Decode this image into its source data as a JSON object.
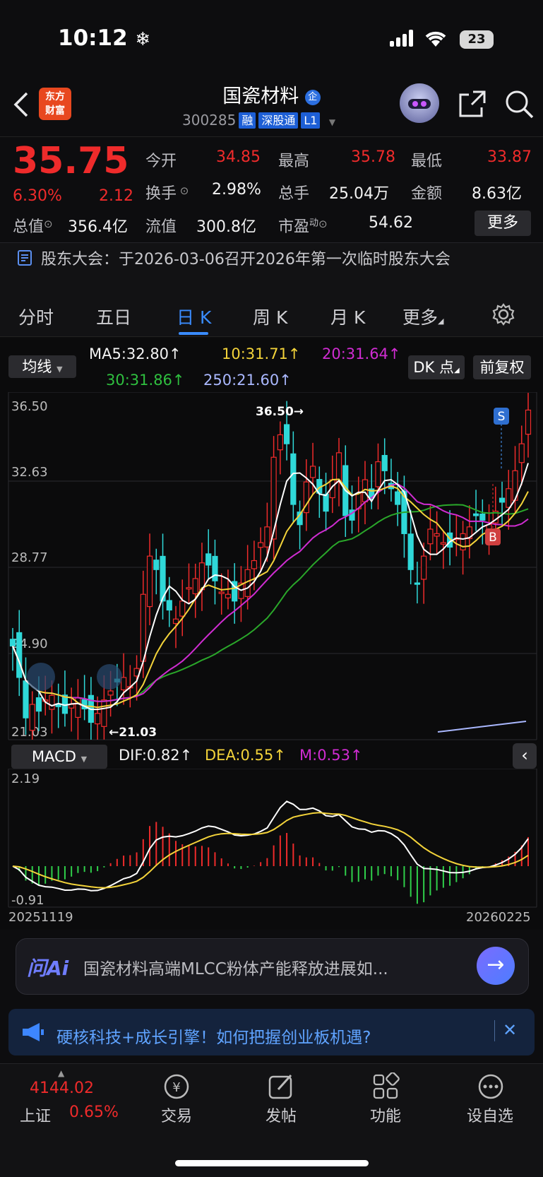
{
  "status": {
    "time": "10:12",
    "battery": "23"
  },
  "header": {
    "logo_line1": "东方",
    "logo_line2": "财富",
    "title": "国瓷材料",
    "title_badge": "企",
    "code": "300285",
    "tags": [
      "融",
      "深股通",
      "L1"
    ]
  },
  "quote": {
    "price": "35.75",
    "change_pct": "6.30%",
    "change": "2.12",
    "open_label": "今开",
    "open": "34.85",
    "high_label": "最高",
    "high": "35.78",
    "low_label": "最低",
    "low": "33.87",
    "turnover_label": "换手",
    "turnover": "2.98%",
    "volume_label": "总手",
    "volume": "25.04万",
    "amount_label": "金额",
    "amount": "8.63亿",
    "mcap_label": "总值",
    "mcap": "356.4亿",
    "float_label": "流值",
    "float": "300.8亿",
    "pe_label": "市盈",
    "pe_sup": "动",
    "pe": "54.62",
    "more": "更多"
  },
  "notice": {
    "text": "股东大会：于2026-03-06召开2026年第一次临时股东大会"
  },
  "tabs": [
    "分时",
    "五日",
    "日 K",
    "周 K",
    "月 K",
    "更多"
  ],
  "chart": {
    "ma_selector": "均线",
    "ma5": "MA5:32.80",
    "ma10": "10:31.71",
    "ma20": "20:31.64",
    "ma30": "30:31.86",
    "ma250": "250:21.60",
    "dk_btn": "DK 点",
    "adj_btn": "前复权",
    "y_ticks": [
      "36.50",
      "32.63",
      "28.77",
      "24.90",
      "21.03"
    ],
    "high_mark": "36.50",
    "low_mark": "21.03",
    "signal_s": "S",
    "signal_b": "B",
    "macd_selector": "MACD",
    "dif": "DIF:0.82",
    "dea": "DEA:0.55",
    "m": "M:0.53",
    "macd_max": "2.19",
    "macd_min": "-0.91",
    "date_start": "20251119",
    "date_end": "20260225",
    "colors": {
      "up": "#ef2b2b",
      "down": "#2fd8d8",
      "ma5": "#ffffff",
      "ma10": "#f3d33a",
      "ma20": "#d02cd2",
      "ma30": "#2aa72a",
      "ma250": "#aab8ff"
    }
  },
  "ai": {
    "logo": "问Ai",
    "prompt": "国瓷材料高端MLCC粉体产能释放进展如..."
  },
  "promo": {
    "text": "硬核科技+成长引擎！如何把握创业板机遇?"
  },
  "bottom_nav": {
    "index_value": "4144.02",
    "index_name": "上证",
    "index_pct": "0.65%",
    "items": [
      "交易",
      "发帖",
      "功能",
      "设自选"
    ]
  }
}
